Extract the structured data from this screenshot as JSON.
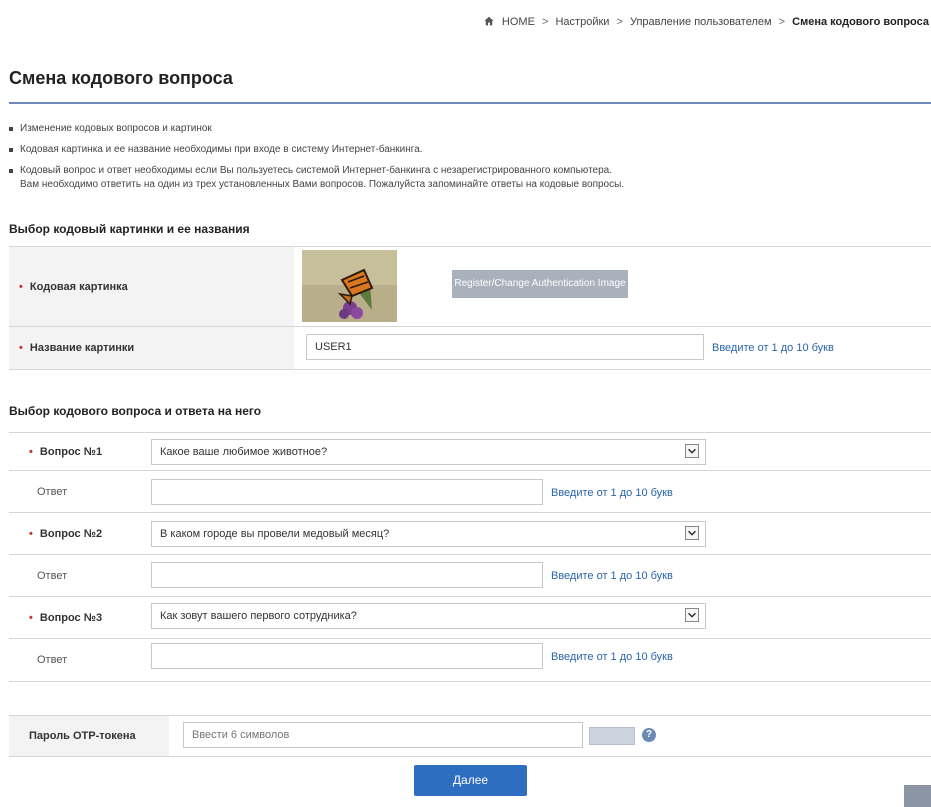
{
  "breadcrumb": {
    "home": "HOME",
    "sep": ">",
    "item1": "Настройки",
    "item2": "Управление пользователем",
    "current": "Смена кодового вопроса"
  },
  "page": {
    "title": "Смена кодового вопроса",
    "bullets": [
      "Изменение кодовых вопросов и картинок",
      "Кодовая картинка и ее название необходимы при входе в систему Интернет-банкинга.",
      "Кодовый вопрос и ответ необходимы если Вы пользуетесь системой Интернет-банкинга с незарегистрированного компьютера."
    ],
    "bullet3_line2": "Вам необходимо ответить на один из трех установленных Вами вопросов. Пожалуйста запоминайте ответы на кодовые вопросы."
  },
  "image_section": {
    "title": "Выбор кодовый картинки и ее названия",
    "image_label": "Кодовая картинка",
    "image_button": "Register/Change Authentication Image",
    "name_label": "Название картинки",
    "name_value": "USER1",
    "name_hint": "Введите от 1 до 10 букв"
  },
  "question_section": {
    "title": "Выбор кодового вопроса и ответа на него",
    "questions": [
      {
        "label": "Вопрос №1",
        "value": "Какое ваше любимое животное?",
        "answer_label": "Ответ",
        "answer_value": "",
        "hint": "Введите от 1 до 10 букв"
      },
      {
        "label": "Вопрос №2",
        "value": "В каком городе вы провели медовый месяц?",
        "answer_label": "Ответ",
        "answer_value": "",
        "hint": "Введите от 1 до 10 букв"
      },
      {
        "label": "Вопрос №3",
        "value": "Как зовут вашего первого сотрудника?",
        "answer_label": "Ответ",
        "answer_value": "",
        "hint": "Введите от 1 до 10 букв"
      }
    ]
  },
  "otp": {
    "label": "Пароль OTP-токена",
    "placeholder": "Ввести 6 символов"
  },
  "actions": {
    "next": "Далее"
  },
  "required_mark": "•",
  "colors": {
    "accent": "#2d6ec0",
    "rule": "#6f8bb3",
    "hint": "#2a64a8",
    "required": "#c0392b"
  }
}
